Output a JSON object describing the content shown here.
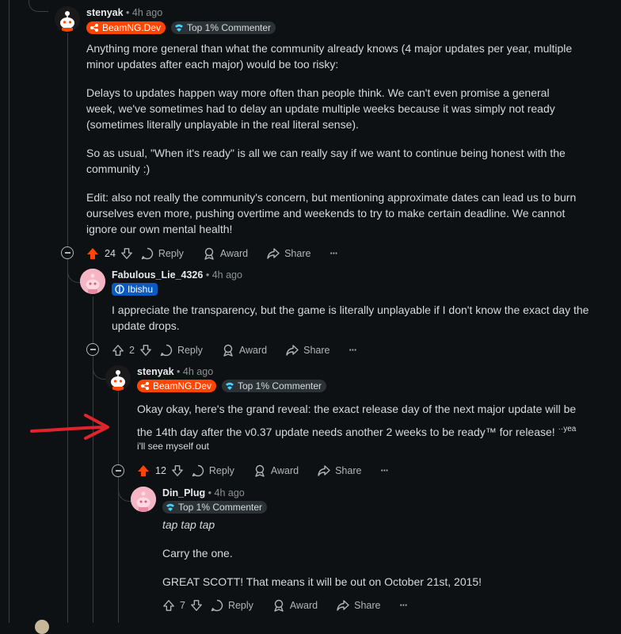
{
  "colors": {
    "background": "#0e1113",
    "text": "#d7dadc",
    "upvote_active": "#ff4500",
    "thread_line": "#3a3f42",
    "arrow_annotation": "#e0242b"
  },
  "comments": [
    {
      "username": "stenyak",
      "time": "4h ago",
      "flairs": [
        "BeamNG.Dev",
        "Top 1% Commenter"
      ],
      "paragraphs": [
        "Anything more general than what the community already knows (4 major updates per year, multiple minor updates after each major) would be too risky:",
        "Delays to updates happen way more often than people think. We can't even promise a general week, we've sometimes had to delay an update multiple weeks because it was simply not ready (sometimes literally unplayable in the real literal sense).",
        "So as usual, \"When it's ready\" is all we can really say if we want to continue being honest with the community :)",
        "Edit: also not really the community's concern, but mentioning approximate dates can lead us to burn ourselves even more, pushing overtime and weekends to try to make certain deadline. We cannot ignore our own mental health!"
      ],
      "score": "24",
      "upvoted": true
    },
    {
      "username": "Fabulous_Lie_4326",
      "time": "4h ago",
      "flairs": [
        "Ibishu"
      ],
      "paragraphs": [
        "I appreciate the transparency, but the game is literally unplayable if I don't know the exact day the update drops."
      ],
      "score": "2",
      "upvoted": false
    },
    {
      "username": "stenyak",
      "time": "4h ago",
      "flairs": [
        "BeamNG.Dev",
        "Top 1% Commenter"
      ],
      "paragraphs": [
        "Okay okay, here's the grand reveal: the exact release day of the next major update will be the 14th day after the v0.37 update needs another 2 weeks to be ready™ for release!"
      ],
      "superscript": "yea",
      "small_line": "i'll see myself out",
      "score": "12",
      "upvoted": true
    },
    {
      "username": "Din_Plug",
      "time": "4h ago",
      "flairs": [
        "Top 1% Commenter"
      ],
      "paragraphs": [
        "tap tap tap",
        "Carry the one.",
        "GREAT SCOTT! That means it will be out on October 21st, 2015!"
      ],
      "score": "7",
      "upvoted": false
    }
  ],
  "actions": {
    "reply": "Reply",
    "award": "Award",
    "share": "Share",
    "more": "···"
  },
  "sep": "•"
}
